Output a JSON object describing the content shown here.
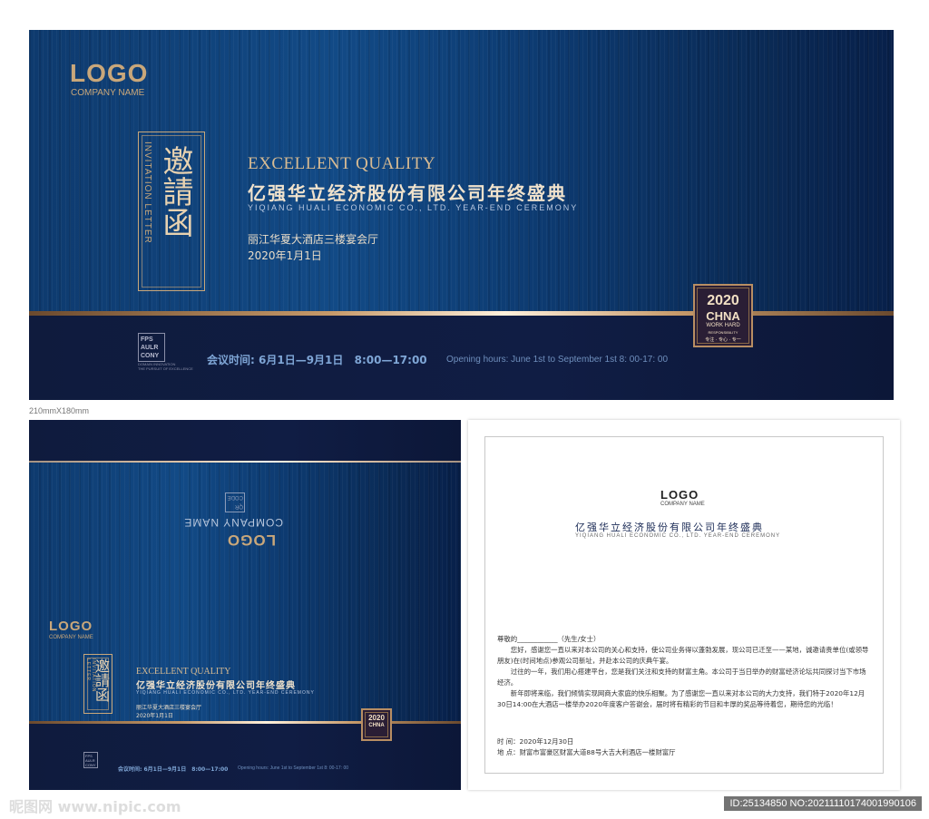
{
  "size_label": "210mmX180mm",
  "card": {
    "logo": "LOGO",
    "company_name": "COMPANY NAME",
    "invite_chars": [
      "邀",
      "請",
      "函"
    ],
    "invite_en": "INVITATION LETTER",
    "headline_en": "EXCELLENT QUALITY",
    "headline_cn": "亿强华立经济股份有限公司年终盛典",
    "headline_sub": "YIQIANG HUALI ECONOMIC CO., LTD. YEAR-END CEREMONY",
    "venue": "丽江华夏大酒店三楼宴会厅",
    "date": "2020年1月1日",
    "badge_year": "2020",
    "badge_word": "CHNA",
    "badge_line1": "WORK HARD",
    "badge_line2": "RESPONSIBILITY",
    "badge_line3": "专注 · 专心 · 专一",
    "small_logo": [
      "FPS",
      "AULR",
      "CONY"
    ],
    "small_logo_tag1": "DOMAIN INNOVATION",
    "small_logo_tag2": "THE PURSUIT OF EXCELLENCE",
    "hours_cn_label": "会议时间:",
    "hours_cn_value": "6月1日—9月1日",
    "hours_cn_time": "8:00—17:00",
    "hours_en": "Opening hours: June 1st to September 1st 8: 00-17: 00"
  },
  "back_cover": {
    "qr_label": "QR CODE",
    "company_name": "COMPANY NAME",
    "logo": "LOGO"
  },
  "letter": {
    "logo": "LOGO",
    "company_name": "COMPANY NAME",
    "title": "亿强华立经济股份有限公司年终盛典",
    "subtitle": "YIQIANG HUALI ECONOMIC CO., LTD. YEAR-END CEREMONY",
    "greeting": "尊敬的____________（先生/女士）",
    "p1": "您好，感谢您一直以来对本公司的关心和支持，使公司业务得以蓬勃发展，现公司已迁至——某地，诚邀请贵单位(或领导朋友)在(时间地点)参观公司新址，并赴本公司的庆典午宴。",
    "p2": "过往的一年，我们用心搭建平台，您是我们关注和支持的财富主角。本公司于当日举办的财富经济论坛共同探讨当下市场经济。",
    "p3": "新年即将来临，我们倾情实现网商大家庭的快乐相聚。为了感谢您一直以来对本公司的大力支持，我们特于2020年12月30日14:00在大酒店一楼举办2020年度客户答谢会，届时将有精彩的节目和丰厚的奖品等待着您，期待您的光临！",
    "time": "时  间：2020年12月30日",
    "place": "地  点：财富市富豪区财富大道88号大吉大利酒店一楼财富厅"
  },
  "watermark": {
    "site": "昵图网 www.nipic.com",
    "id": "ID:25134850 NO:20211110174001990106"
  }
}
